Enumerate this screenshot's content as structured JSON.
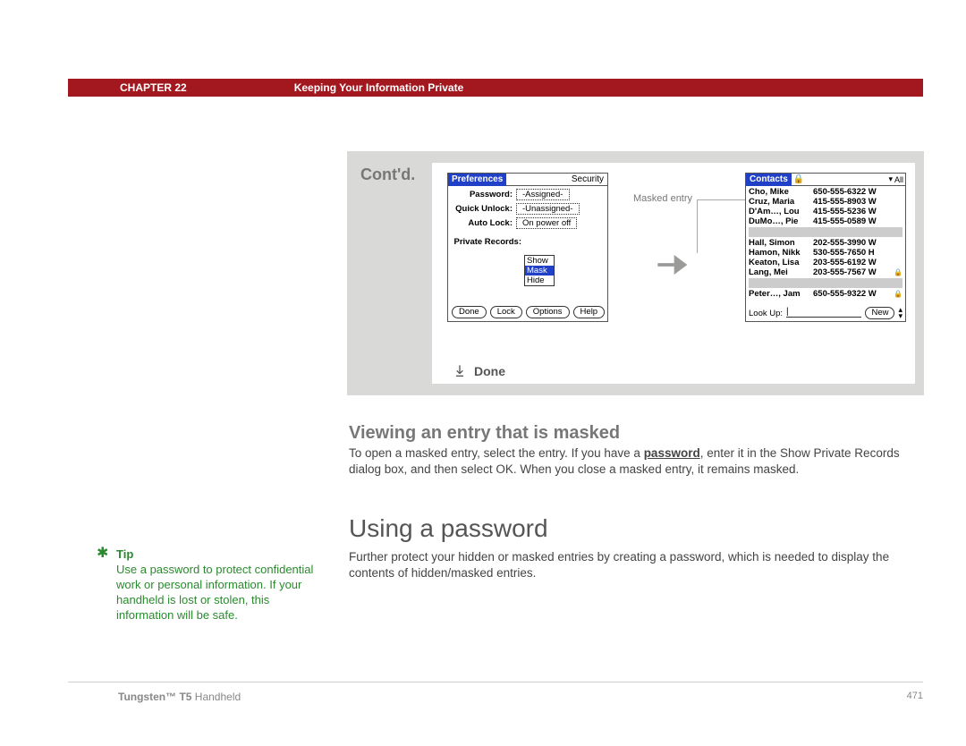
{
  "header": {
    "chapter": "CHAPTER 22",
    "title": "Keeping Your Information Private"
  },
  "gray": {
    "contd": "Cont'd.",
    "done": "Done",
    "masked_label": "Masked entry"
  },
  "prefs": {
    "title_left": "Preferences",
    "title_right": "Security",
    "rows": {
      "password_label": "Password:",
      "password_value": "-Assigned-",
      "quick_label": "Quick Unlock:",
      "quick_value": "-Unassigned-",
      "auto_label": "Auto Lock:",
      "auto_value": "On power off",
      "private_label": "Private Records:"
    },
    "list": {
      "show": "Show",
      "mask": "Mask",
      "hide": "Hide"
    },
    "buttons": {
      "done": "Done",
      "lock": "Lock",
      "options": "Options",
      "help": "Help"
    }
  },
  "contacts": {
    "title_left": "Contacts",
    "title_right": "All",
    "rows": [
      {
        "name": "Cho, Mike",
        "phone": "650-555-6322 W",
        "lock": false
      },
      {
        "name": "Cruz, Maria",
        "phone": "415-555-8903 W",
        "lock": false
      },
      {
        "name": "D'Am…, Lou",
        "phone": "415-555-5236 W",
        "lock": false
      },
      {
        "name": "DuMo…, Pie",
        "phone": "415-555-0589 W",
        "lock": false
      }
    ],
    "rows2": [
      {
        "name": "Hall, Simon",
        "phone": "202-555-3990 W",
        "lock": false
      },
      {
        "name": "Hamon, Nikk",
        "phone": "530-555-7650 H",
        "lock": false
      },
      {
        "name": "Keaton, Lisa",
        "phone": "203-555-6192 W",
        "lock": false
      },
      {
        "name": "Lang, Mei",
        "phone": "203-555-7567 W",
        "lock": true
      }
    ],
    "rows3": [
      {
        "name": "Peter…, Jam",
        "phone": "650-555-9322 W",
        "lock": true
      }
    ],
    "lookup": "Look Up:",
    "new": "New"
  },
  "section1": {
    "heading": "Viewing an entry that is masked",
    "p_pre": "To open a masked entry, select the entry. If you have a ",
    "p_link": "password",
    "p_post": ", enter it in the Show Private Records dialog box, and then select OK. When you close a masked entry, it remains masked."
  },
  "section2": {
    "heading": "Using a password",
    "p": "Further protect your hidden or masked entries by creating a password, which is needed to display the contents of hidden/masked entries."
  },
  "tip": {
    "title": "Tip",
    "body": "Use a password to protect confidential work or personal information. If your handheld is lost or stolen, this information will be safe."
  },
  "footer": {
    "product_bold": "Tungsten™ T5",
    "product_rest": " Handheld",
    "page": "471"
  }
}
